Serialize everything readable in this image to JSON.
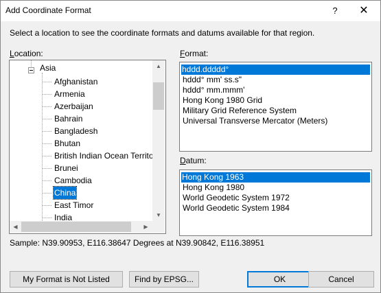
{
  "window": {
    "title": "Add Coordinate Format",
    "help_label": "?",
    "close_label": "✕"
  },
  "instruction": "Select a location to see the coordinate formats and datums available for that region.",
  "location": {
    "label_underline": "L",
    "label_rest": "ocation:",
    "expander_icon": "minus-box",
    "parent_node": "Asia",
    "items": [
      {
        "label": "Afghanistan",
        "selected": false
      },
      {
        "label": "Armenia",
        "selected": false
      },
      {
        "label": "Azerbaijan",
        "selected": false
      },
      {
        "label": "Bahrain",
        "selected": false
      },
      {
        "label": "Bangladesh",
        "selected": false
      },
      {
        "label": "Bhutan",
        "selected": false
      },
      {
        "label": "British Indian Ocean Territor",
        "selected": false
      },
      {
        "label": "Brunei",
        "selected": false
      },
      {
        "label": "Cambodia",
        "selected": false
      },
      {
        "label": "China",
        "selected": true
      },
      {
        "label": "East Timor",
        "selected": false
      },
      {
        "label": "India",
        "selected": false
      }
    ],
    "scroll_up_icon": "▲",
    "scroll_down_icon": "▼",
    "scroll_left_icon": "◀",
    "scroll_right_icon": "▶"
  },
  "format": {
    "label_underline": "F",
    "label_rest": "ormat:",
    "items": [
      {
        "label": "hddd.ddddd°",
        "selected": true
      },
      {
        "label": "hddd° mm' ss.s\"",
        "selected": false
      },
      {
        "label": "hddd° mm.mmm'",
        "selected": false
      },
      {
        "label": "Hong Kong 1980 Grid",
        "selected": false
      },
      {
        "label": "Military Grid Reference System",
        "selected": false
      },
      {
        "label": "Universal Transverse Mercator (Meters)",
        "selected": false
      }
    ]
  },
  "datum": {
    "label_underline": "D",
    "label_rest": "atum:",
    "items": [
      {
        "label": "Hong Kong 1963",
        "selected": true
      },
      {
        "label": "Hong Kong 1980",
        "selected": false
      },
      {
        "label": "World Geodetic System 1972",
        "selected": false
      },
      {
        "label": "World Geodetic System 1984",
        "selected": false
      }
    ]
  },
  "sample": "Sample: N39.90953, E116.38647 Degrees at N39.90842, E116.38951",
  "buttons": {
    "not_listed": "My Format is Not Listed",
    "find_epsg": "Find by EPSG...",
    "ok": "OK",
    "cancel": "Cancel"
  },
  "colors": {
    "selection": "#0078d7",
    "dialog_bg": "#f0f0f0"
  }
}
